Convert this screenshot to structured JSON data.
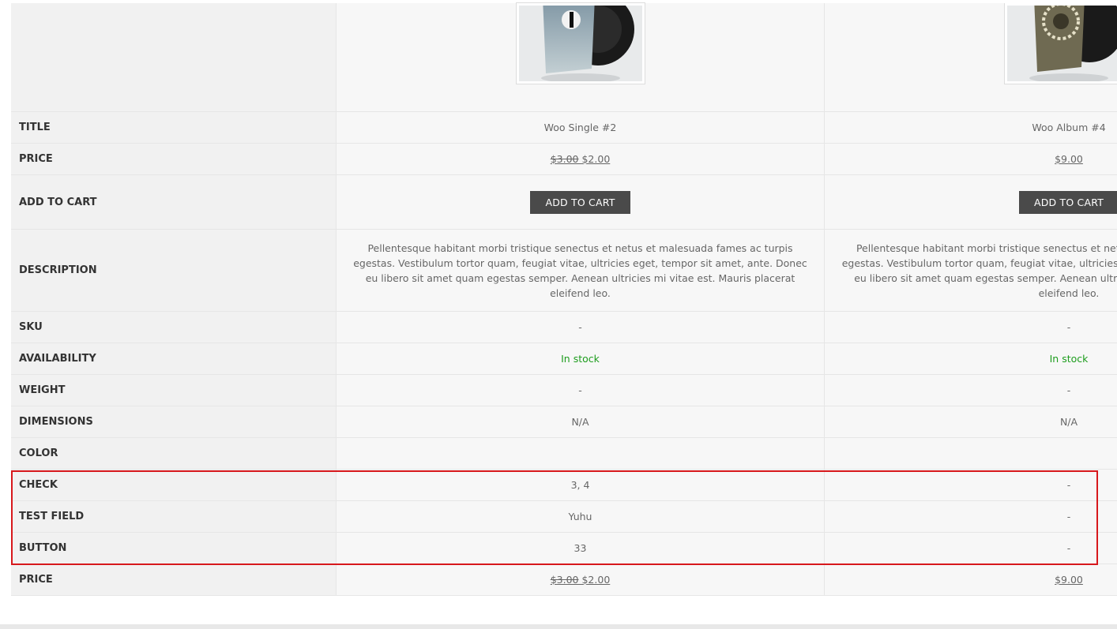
{
  "products": [
    {
      "image_alt": "Woo Single #2 vinyl",
      "title": "Woo Single #2",
      "price_old": "$3.00",
      "price_new": "$2.00",
      "cart_label": "ADD TO CART",
      "description": "Pellentesque habitant morbi tristique senectus et netus et malesuada fames ac turpis egestas. Vestibulum tortor quam, feugiat vitae, ultricies eget, tempor sit amet, ante. Donec eu libero sit amet quam egestas semper. Aenean ultricies mi vitae est. Mauris placerat eleifend leo.",
      "sku": "-",
      "availability": "In stock",
      "weight": "-",
      "dimensions": "N/A",
      "color": "",
      "check": "3, 4",
      "test_field": "Yuhu",
      "button": "33"
    },
    {
      "image_alt": "Woo Album #4 vinyl",
      "title": "Woo Album #4",
      "price_old": "",
      "price_new": "$9.00",
      "cart_label": "ADD TO CART",
      "description": "Pellentesque habitant morbi tristique senectus et netus et malesuada fames ac turpis egestas. Vestibulum tortor quam, feugiat vitae, ultricies eget, tempor sit amet, ante. Donec eu libero sit amet quam egestas semper. Aenean ultricies mi vitae est. Mauris placerat eleifend leo.",
      "sku": "-",
      "availability": "In stock",
      "weight": "-",
      "dimensions": "N/A",
      "color": "",
      "check": "-",
      "test_field": "-",
      "button": "-"
    }
  ],
  "labels": {
    "title": "TITLE",
    "price": "PRICE",
    "add_to_cart": "ADD TO CART",
    "description": "DESCRIPTION",
    "sku": "SKU",
    "availability": "AVAILABILITY",
    "weight": "WEIGHT",
    "dimensions": "DIMENSIONS",
    "color": "COLOR",
    "check": "CHECK",
    "test_field": "TEST FIELD",
    "button": "BUTTON",
    "price_bottom": "PRICE"
  },
  "colors": {
    "in_stock": "#1d9d1d",
    "highlight_border": "#d7181c",
    "button_bg": "#4a4a4a"
  }
}
